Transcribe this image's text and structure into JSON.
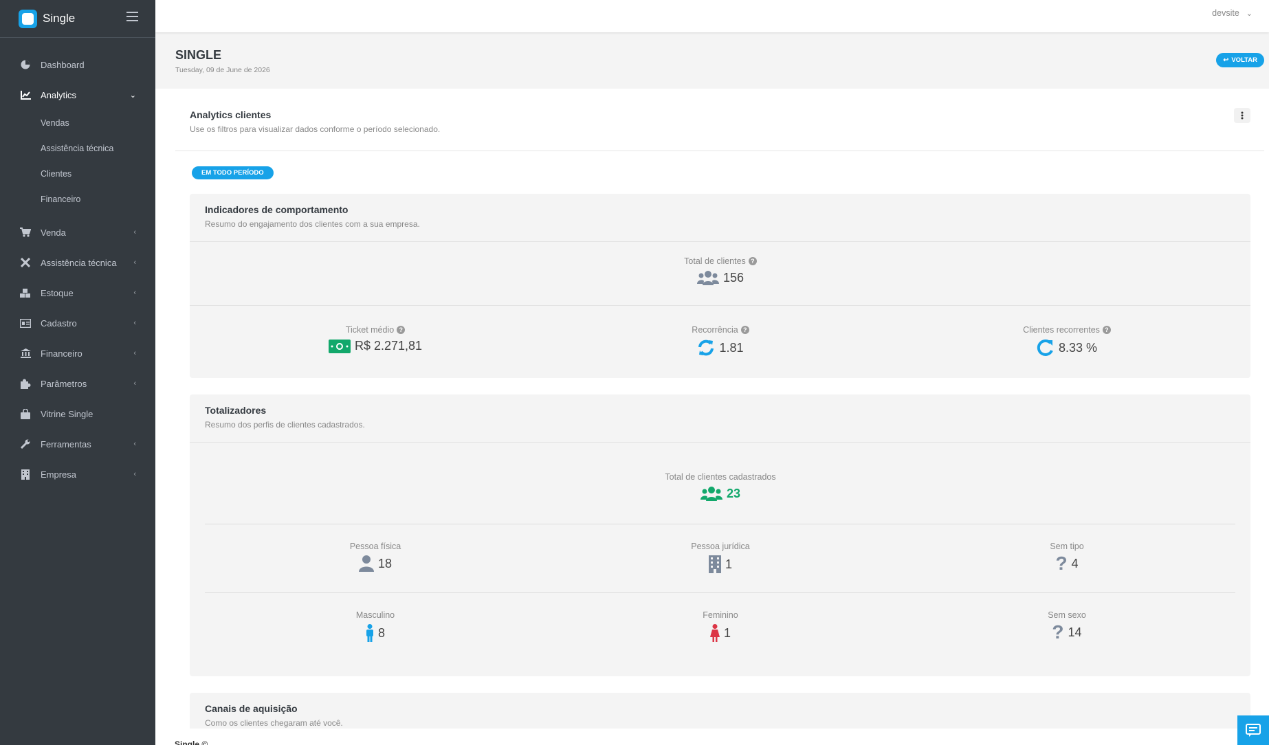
{
  "brand": {
    "name": "Single"
  },
  "sidebar": {
    "items": [
      {
        "label": "Dashboard",
        "icon": "chart-pie-icon"
      },
      {
        "label": "Analytics",
        "icon": "chart-line-icon"
      },
      {
        "label": "Venda",
        "icon": "cart-icon"
      },
      {
        "label": "Assistência técnica",
        "icon": "tools-icon"
      },
      {
        "label": "Estoque",
        "icon": "boxes-icon"
      },
      {
        "label": "Cadastro",
        "icon": "id-card-icon"
      },
      {
        "label": "Financeiro",
        "icon": "bank-icon"
      },
      {
        "label": "Parâmetros",
        "icon": "puzzle-icon"
      },
      {
        "label": "Vitrine Single",
        "icon": "shopping-bag-icon"
      },
      {
        "label": "Ferramentas",
        "icon": "wrench-icon"
      },
      {
        "label": "Empresa",
        "icon": "building-icon"
      }
    ],
    "analytics_sub": [
      "Vendas",
      "Assistência técnica",
      "Clientes",
      "Financeiro"
    ]
  },
  "topbar": {
    "user": "devsite"
  },
  "header": {
    "title": "SINGLE",
    "date": "Tuesday, 09 de June de 2026",
    "back_label": "VOLTAR"
  },
  "card": {
    "title": "Analytics clientes",
    "subtitle": "Use os filtros para visualizar dados conforme o período selecionado.",
    "period_badge": "EM TODO PERÍODO"
  },
  "behavior": {
    "title": "Indicadores de comportamento",
    "subtitle": "Resumo do engajamento dos clientes com a sua empresa.",
    "total_label": "Total de clientes",
    "total_value": "156",
    "ticket_label": "Ticket médio",
    "ticket_value": "R$ 2.271,81",
    "recurrence_label": "Recorrência",
    "recurrence_value": "1.81",
    "recurring_label": "Clientes recorrentes",
    "recurring_value": "8.33 %"
  },
  "totals": {
    "title": "Totalizadores",
    "subtitle": "Resumo dos perfis de clientes cadastrados.",
    "registered_label": "Total de clientes cadastrados",
    "registered_value": "23",
    "pf_label": "Pessoa física",
    "pf_value": "18",
    "pj_label": "Pessoa jurídica",
    "pj_value": "1",
    "notype_label": "Sem tipo",
    "notype_value": "4",
    "male_label": "Masculino",
    "male_value": "8",
    "female_label": "Feminino",
    "female_value": "1",
    "nosex_label": "Sem sexo",
    "nosex_value": "14"
  },
  "channels": {
    "title": "Canais de aquisição",
    "subtitle": "Como os clientes chegaram até você."
  },
  "footer": {
    "text": "Single ©"
  },
  "colors": {
    "accent": "#17a2e8",
    "sidebar": "#343a40",
    "green": "#12a86b",
    "red": "#dc3545"
  }
}
